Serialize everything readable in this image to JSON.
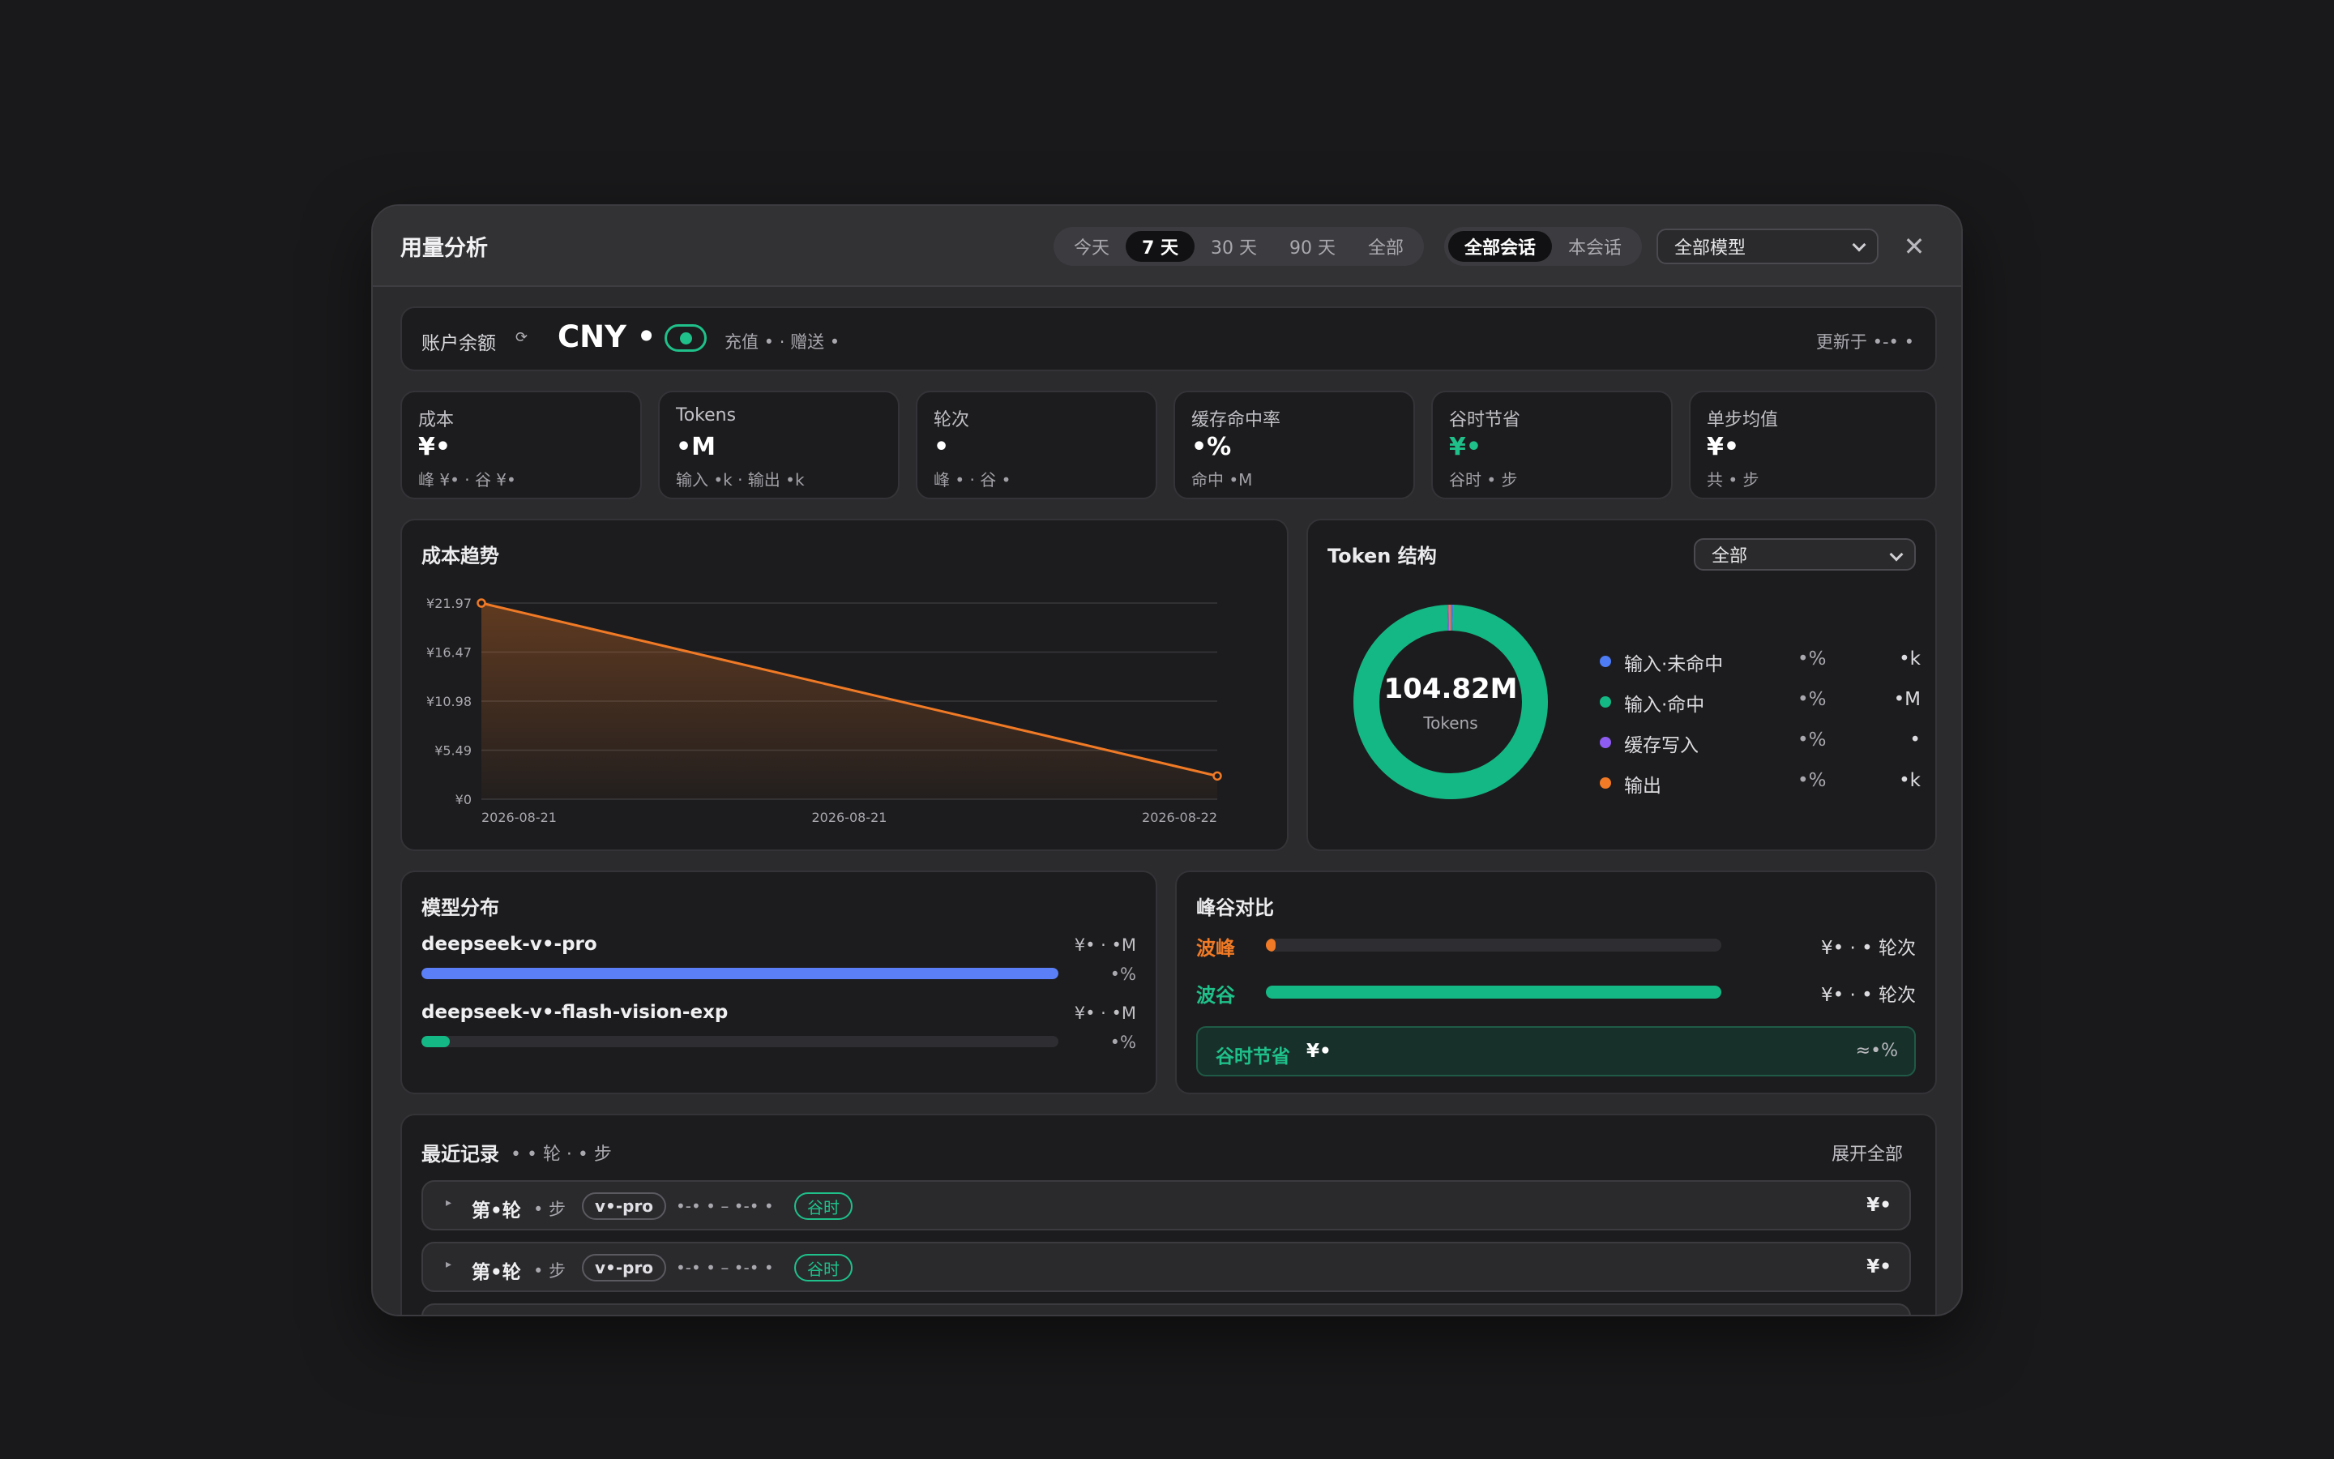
{
  "header": {
    "title": "用量分析",
    "ranges": [
      "今天",
      "7 天",
      "30 天",
      "90 天",
      "全部"
    ],
    "active_range": "7 天",
    "scopes": [
      "全部会话",
      "本会话"
    ],
    "active_scope": "全部会话",
    "model_filter": "全部模型",
    "close": "✕"
  },
  "balance": {
    "label": "账户余额",
    "refresh_icon": "⟳",
    "amount": "CNY •",
    "detail": "充值 • · 赠送 •",
    "updated": "更新于 •-• •",
    "toggle_on": true
  },
  "stats": [
    {
      "label": "成本",
      "value": "¥•",
      "sub": "峰 ¥• · 谷 ¥•"
    },
    {
      "label": "Tokens",
      "value": "•M",
      "sub": "输入 •k · 输出 •k"
    },
    {
      "label": "轮次",
      "value": "•",
      "sub": "峰 • · 谷 •"
    },
    {
      "label": "缓存命中率",
      "value": "•%",
      "sub": "命中 •M"
    },
    {
      "label": "谷时节省",
      "value": "¥•",
      "sub": "谷时 • 步"
    },
    {
      "label": "单步均值",
      "value": "¥•",
      "sub": "共 • 步"
    }
  ],
  "cost_trend": {
    "title": "成本趋势"
  },
  "chart_data": {
    "type": "area",
    "title": "成本趋势",
    "xlabel": "",
    "ylabel": "",
    "x": [
      "2026-08-21",
      "2026-08-22"
    ],
    "x_tick_labels": [
      "2026-08-21",
      "2026-08-21",
      "2026-08-22"
    ],
    "y_tick_labels": [
      "¥21.97",
      "¥16.47",
      "¥10.98",
      "¥5.49",
      "¥0"
    ],
    "series": [
      {
        "values": [
          21.97,
          2.6
        ]
      }
    ],
    "ylim": [
      0,
      21.97
    ],
    "grid": true,
    "line_color": "#f07a26"
  },
  "token_structure": {
    "title": "Token 结构",
    "filter": "全部",
    "total": "104.82M",
    "total_label": "Tokens",
    "items": [
      {
        "name": "输入·未命中",
        "pct": "•%",
        "value": "•k",
        "color": "#4d7cf5"
      },
      {
        "name": "输入·命中",
        "pct": "•%",
        "value": "•M",
        "color": "#14b884"
      },
      {
        "name": "缓存写入",
        "pct": "•%",
        "value": "•",
        "color": "#8e5cf0"
      },
      {
        "name": "输出",
        "pct": "•%",
        "value": "•k",
        "color": "#f07a26"
      }
    ],
    "donut_fractions": [
      0.004,
      0.99,
      0.002,
      0.004
    ]
  },
  "model_dist": {
    "title": "模型分布",
    "models": [
      {
        "name": "deepseek-v•-pro",
        "cost": "¥• · •M",
        "pct": "•%",
        "fill": 1.0,
        "color": "#5b7ff6"
      },
      {
        "name": "deepseek-v•-flash-vision-exp",
        "cost": "¥• · •M",
        "pct": "•%",
        "fill": 0.045,
        "color": "#14b884"
      }
    ]
  },
  "peak_valley": {
    "title": "峰谷对比",
    "rows": [
      {
        "label": "波峰",
        "value": "¥• · • 轮次",
        "fill": 0.02,
        "color": "#f07a26"
      },
      {
        "label": "波谷",
        "value": "¥• · • 轮次",
        "fill": 1.0,
        "color": "#14b884"
      }
    ],
    "saving_label": "谷时节省",
    "saving_amount": "¥•",
    "saving_ratio": "≈•%"
  },
  "records": {
    "title": "最近记录",
    "count": "• • 轮 · • 步",
    "expand": "展开全部",
    "rows": [
      {
        "caret": "▸",
        "turn": "第•轮",
        "steps": "• 步",
        "model": "v•-pro",
        "time": "•-• • – •-• •",
        "tag": "谷时",
        "cost": "¥•"
      },
      {
        "caret": "▸",
        "turn": "第•轮",
        "steps": "• 步",
        "model": "v•-pro",
        "time": "•-• • – •-• •",
        "tag": "谷时",
        "cost": "¥•"
      }
    ]
  }
}
